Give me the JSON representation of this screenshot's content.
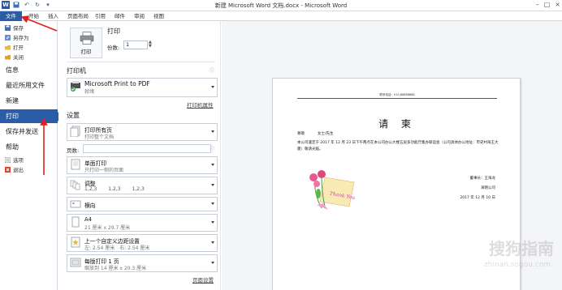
{
  "window": {
    "title": "新建 Microsoft Word 文档.docx - Microsoft Word"
  },
  "ribbon": {
    "tabs": [
      "文件",
      "开始",
      "插入",
      "页面布局",
      "引用",
      "邮件",
      "审阅",
      "视图"
    ]
  },
  "nav": {
    "small": [
      "保存",
      "另存为",
      "打开",
      "关闭"
    ],
    "items": [
      "信息",
      "最近所用文件",
      "新建",
      "打印",
      "保存并发送",
      "帮助"
    ],
    "bottom": [
      "选项",
      "退出"
    ],
    "active": "打印"
  },
  "print": {
    "section_title": "打印",
    "button_label": "打印",
    "copies_label": "份数:",
    "copies_value": "1"
  },
  "printer": {
    "section_title": "打印机",
    "name": "Microsoft Print to PDF",
    "status": "就绪",
    "properties_link": "打印机属性"
  },
  "settings": {
    "section_title": "设置",
    "range": {
      "title": "打印所有页",
      "sub": "打印整个文档"
    },
    "pages_label": "页数:",
    "sides": {
      "title": "单面打印",
      "sub": "只打印一侧的页面"
    },
    "collate": {
      "title": "调整",
      "nums": [
        "1,2,3",
        "1,2,3",
        "1,2,3"
      ]
    },
    "orientation": {
      "title": "横向"
    },
    "paper": {
      "title": "A4",
      "sub": "21 厘米 x 29.7 厘米"
    },
    "margins": {
      "title": "上一个自定义边距设置",
      "sub": "左: 2.54 厘米　右: 2.54 厘米"
    },
    "per_sheet": {
      "title": "每版打印 1 页",
      "sub": "缩放到 14 厘米 x 20.3 厘米"
    },
    "page_setup_link": "页面设置"
  },
  "preview": {
    "header": "联系电话：010-88888888",
    "doc_title": "请 柬",
    "greeting": [
      "尊敬",
      "女士/先生"
    ],
    "body": "本公司谨定于 2017 年 12 月 23 日下午两点在本公司办公大楼五层多功能厅集办联谊会（公司具体办公地址：市史村海王大厦）敬请光临。",
    "sign_title": "董事长：王海龙",
    "sign_company": "海明公司",
    "sign_date": "2017 年 12 月 10 日",
    "card_text": "Thank You",
    "watermark": "搜狗指南",
    "watermark_sub": "zhinan.sogou.com"
  },
  "colors": {
    "accent": "#2a5da8",
    "arrow": "#e02020"
  }
}
